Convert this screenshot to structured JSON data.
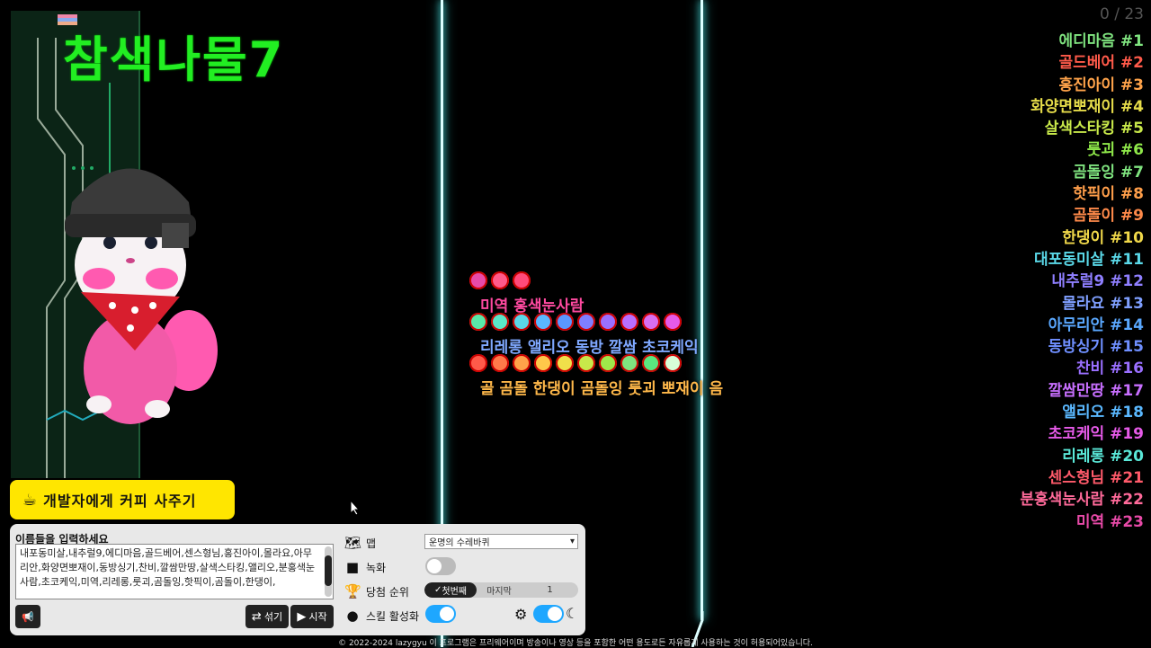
{
  "overlay": {
    "title": "참색나물7"
  },
  "race": {
    "counter": "0 / 23",
    "rankings": [
      {
        "label": "에디마음 #1",
        "color": "#7fe37f"
      },
      {
        "label": "골드베어 #2",
        "color": "#ff5a4a"
      },
      {
        "label": "홍진아이 #3",
        "color": "#ffa34a"
      },
      {
        "label": "화양면뽀재이 #4",
        "color": "#e6dc4a"
      },
      {
        "label": "살색스타킹 #5",
        "color": "#c8e84a"
      },
      {
        "label": "룻괴 #6",
        "color": "#8fe84a"
      },
      {
        "label": "곰돌잉 #7",
        "color": "#7fe37f"
      },
      {
        "label": "핫픽이 #8",
        "color": "#ff9e4a"
      },
      {
        "label": "곰돌이 #9",
        "color": "#ff8a4a"
      },
      {
        "label": "한댕이 #10",
        "color": "#f0d84a"
      },
      {
        "label": "대포동미살 #11",
        "color": "#5ad8e8"
      },
      {
        "label": "내추럴9 #12",
        "color": "#8f7fff"
      },
      {
        "label": "몰라요 #13",
        "color": "#7f9fff"
      },
      {
        "label": "아무리안 #14",
        "color": "#5aa8ff"
      },
      {
        "label": "동방싱기 #15",
        "color": "#6f8fff"
      },
      {
        "label": "찬비 #16",
        "color": "#9a6fff"
      },
      {
        "label": "깔쌈만땅 #17",
        "color": "#c86fff"
      },
      {
        "label": "앨리오 #18",
        "color": "#5ab8ff"
      },
      {
        "label": "초코케익 #19",
        "color": "#e65ae8"
      },
      {
        "label": "리레롱 #20",
        "color": "#5ae8d8"
      },
      {
        "label": "센스형님 #21",
        "color": "#ff5a6a"
      },
      {
        "label": "분홍색눈사람 #22",
        "color": "#ff6a9a"
      },
      {
        "label": "미역 #23",
        "color": "#e84aa8"
      }
    ],
    "marble_rows": [
      {
        "colors": [
          "#e84aa8",
          "#ff5a8a",
          "#ff4a7a"
        ],
        "label": "미역 홍색눈사람",
        "label_color": "#ff4aa0"
      },
      {
        "colors": [
          "#5ae8a8",
          "#5ae8c8",
          "#5ad8e8",
          "#5ab8ff",
          "#5a98ff",
          "#7f7fff",
          "#9a6fff",
          "#b86fff",
          "#d86ff0",
          "#e65ae8"
        ],
        "label": "리레롱 앨리오 동방 깔쌈 초코케익",
        "label_color": "#7fa8ff"
      },
      {
        "colors": [
          "#ff5a4a",
          "#ff7a4a",
          "#ffa34a",
          "#ffc84a",
          "#f0e04a",
          "#c8e84a",
          "#9fe84a",
          "#7fe37f",
          "#5ae87f",
          "#d8ffd8"
        ],
        "label": "골 곰돌 한댕이 곰돌잉 룻괴 뽀재이 음",
        "label_color": "#ffb84a"
      }
    ]
  },
  "coffee": {
    "label": "개발자에게 커피 사주기",
    "icon": "coffee-cup-icon"
  },
  "panel": {
    "names_label": "이름들을 입력하세요",
    "names_value": "내포동미살,내추럴9,에디마음,골드베어,센스형님,홍진아이,몰라요,아무리안,화양면뽀재이,동방싱기,찬비,깔쌈만땅,살색스타킹,앨리오,분홍색눈사람,초코케익,미역,리레롱,룻괴,곰돌잉,핫픽이,곰돌이,한댕이,",
    "shuffle_label": "섞기",
    "start_label": "시작",
    "map_label": "맵",
    "map_value": "운명의 수레바퀴",
    "record_label": "녹화",
    "winner_label": "당첨 순위",
    "winner_first": "첫번째",
    "winner_last": "마지막",
    "winner_count": "1",
    "skill_label": "스킬 활성화"
  },
  "footer": {
    "text": "© 2022-2024 lazygyu 이 프로그램은 프리웨어이며 방송이나 영상 등을 포함한 어떤 용도로든 자유롭게 사용하는 것이 허용되어있습니다."
  }
}
